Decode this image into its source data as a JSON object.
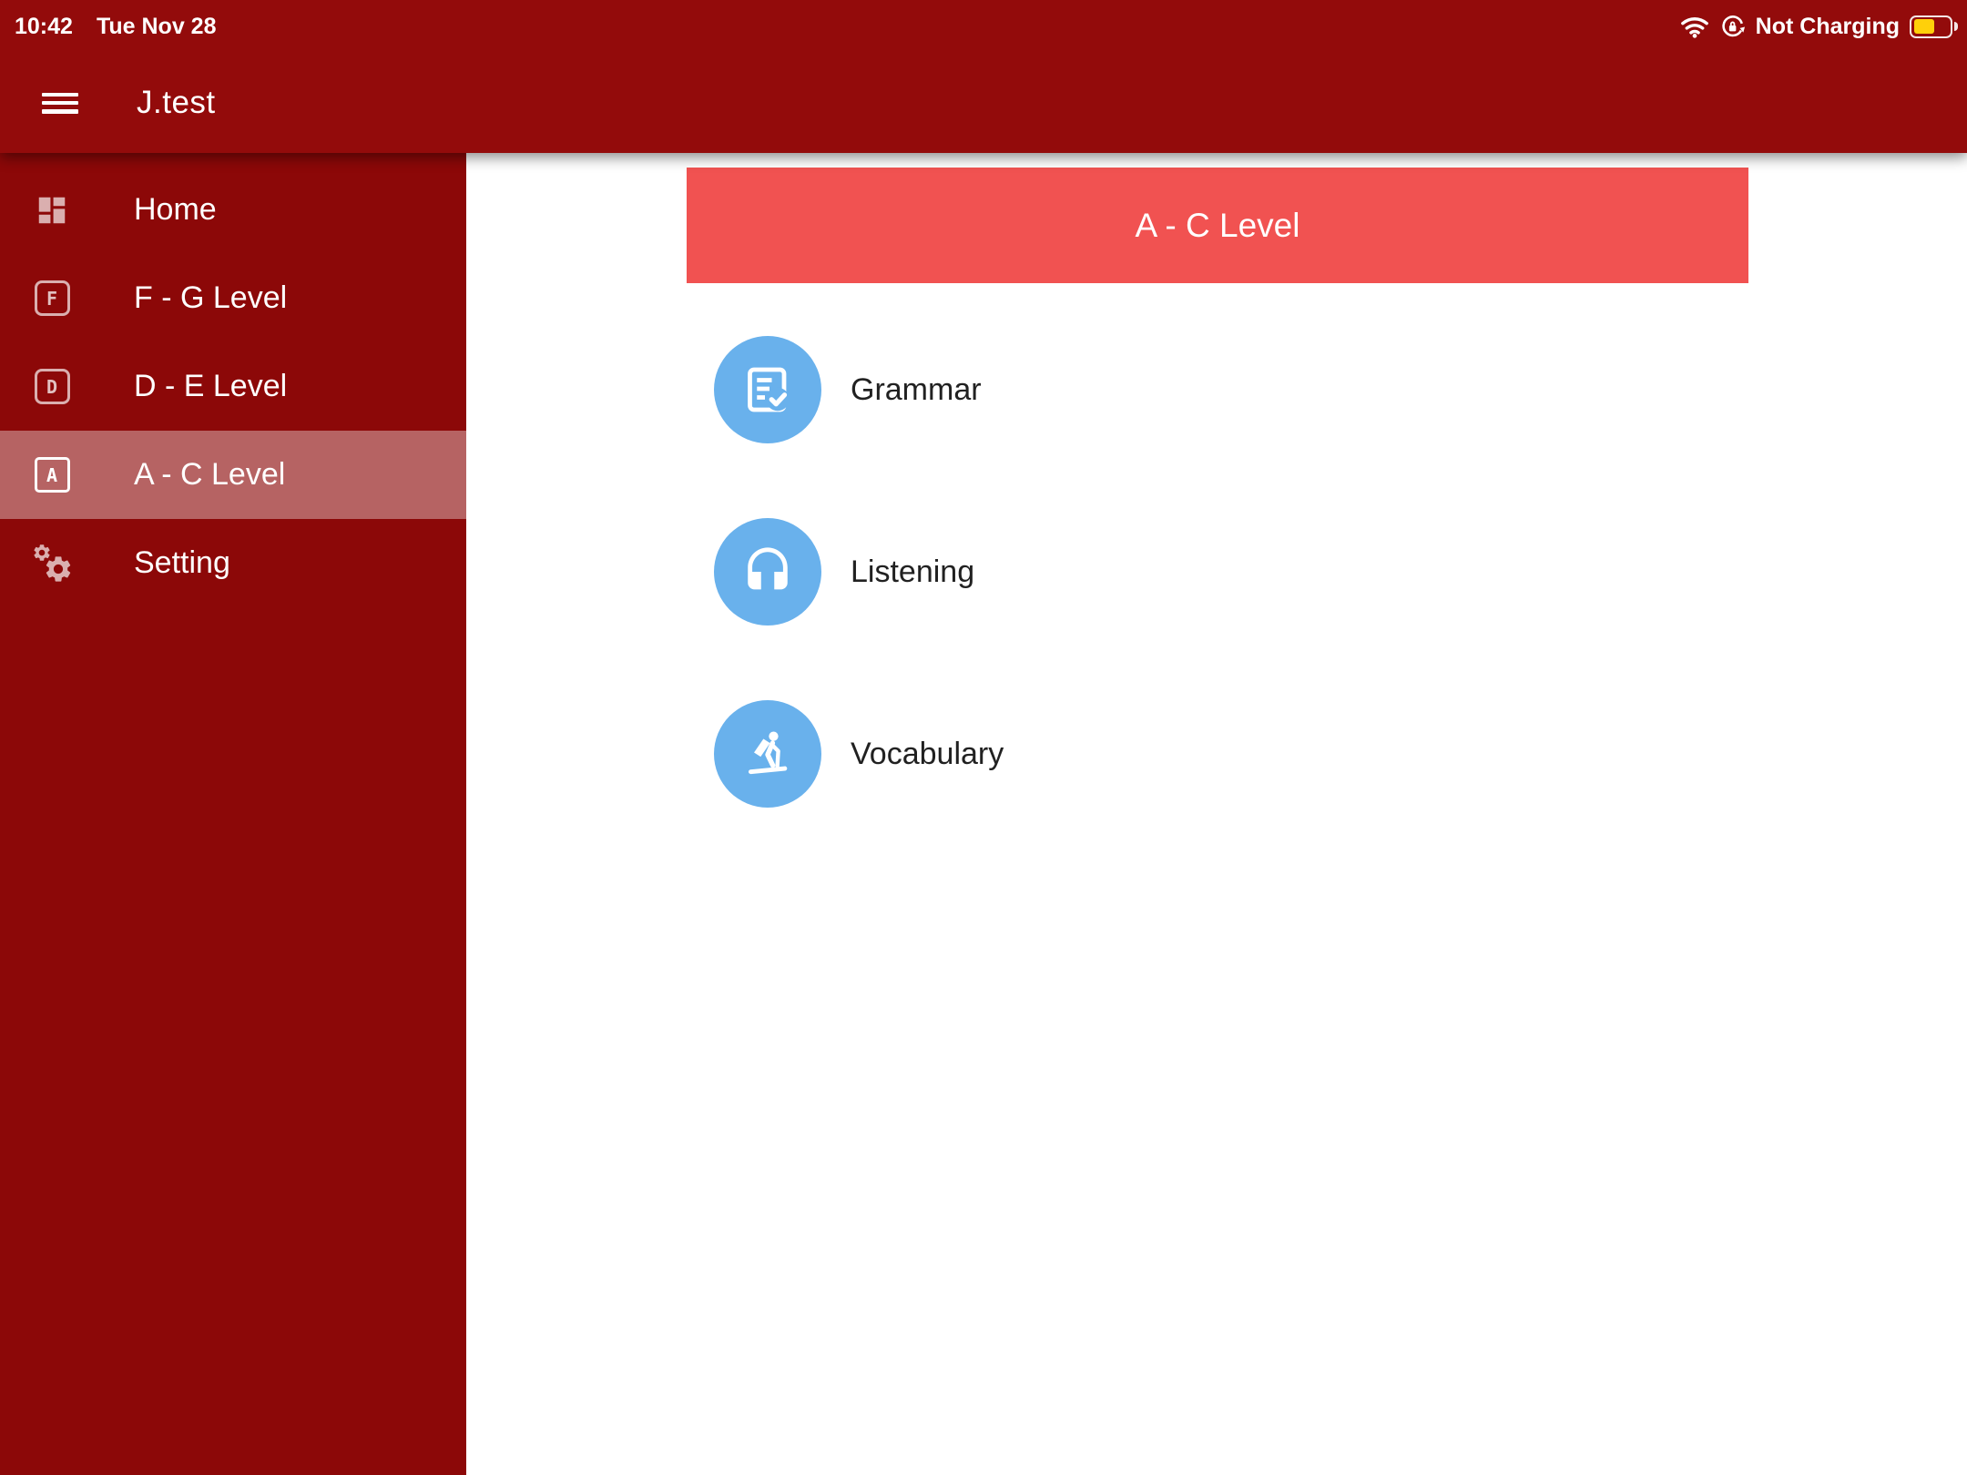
{
  "status_bar": {
    "time": "10:42",
    "date": "Tue Nov 28",
    "battery_status": "Not Charging",
    "battery_level_percent": 60,
    "icons": [
      "wifi-icon",
      "rotation-lock-icon",
      "battery-icon"
    ]
  },
  "app_bar": {
    "title": "J.test",
    "menu_icon": "hamburger-menu-icon"
  },
  "sidebar": {
    "items": [
      {
        "label": "Home",
        "icon": "dashboard-icon",
        "selected": false
      },
      {
        "label": "F - G Level",
        "icon": "letter-f-icon",
        "letter": "F",
        "selected": false
      },
      {
        "label": "D - E Level",
        "icon": "letter-d-icon",
        "letter": "D",
        "selected": false
      },
      {
        "label": "A - C Level",
        "icon": "letter-a-icon",
        "letter": "A",
        "selected": true
      },
      {
        "label": "Setting",
        "icon": "gears-icon",
        "selected": false
      }
    ]
  },
  "main": {
    "banner_title": "A - C Level",
    "menu": [
      {
        "label": "Grammar",
        "icon": "document-check-icon"
      },
      {
        "label": "Listening",
        "icon": "headphones-icon"
      },
      {
        "label": "Vocabulary",
        "icon": "skier-icon"
      }
    ]
  },
  "colors": {
    "header_red": "#930B0B",
    "sidebar_red": "#8C0808",
    "selected_row": "#B45F5F",
    "banner_red": "#F15251",
    "circle_blue": "#69B1EC",
    "battery_yellow": "#FFD00A",
    "menu_label_dark": "#212121"
  }
}
